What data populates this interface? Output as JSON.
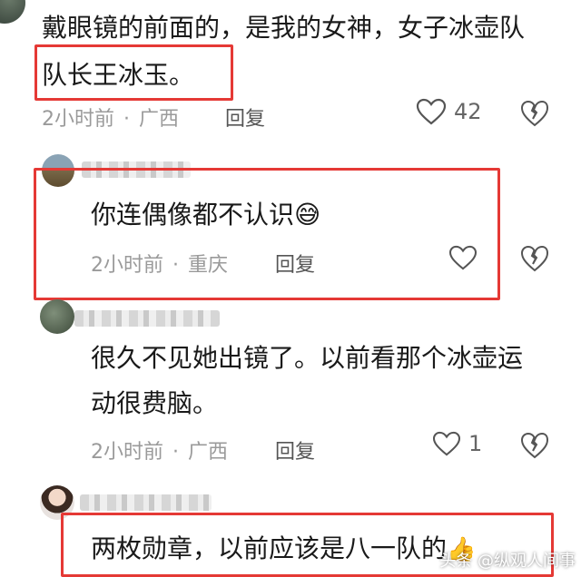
{
  "comments": [
    {
      "text_line1": "戴眼镜的前面的，是我的女神，女子冰壶队",
      "text_line2": "队长王冰玉。",
      "time": "2小时前",
      "location": "广西",
      "reply_label": "回复",
      "like_count": "42"
    },
    {
      "text_line1": "你连偶像都不认识",
      "emoji": "😅",
      "time": "2小时前",
      "location": "重庆",
      "reply_label": "回复",
      "like_count": ""
    },
    {
      "text_line1": "很久不见她出镜了。以前看那个冰壶运",
      "text_line2": "动很费脑。",
      "time": "2小时前",
      "location": "广西",
      "reply_label": "回复",
      "like_count": "1"
    },
    {
      "text_line1": "两枚勋章，以前应该是八一队的",
      "emoji": "👍"
    }
  ],
  "watermark": "头条 @纵观人间事",
  "colors": {
    "highlight_box": "#e53935",
    "meta_text": "#9a9a9a"
  },
  "icons": [
    "heart-outline-icon",
    "broken-heart-icon",
    "thumbs-up-emoji",
    "sweat-smile-emoji"
  ]
}
